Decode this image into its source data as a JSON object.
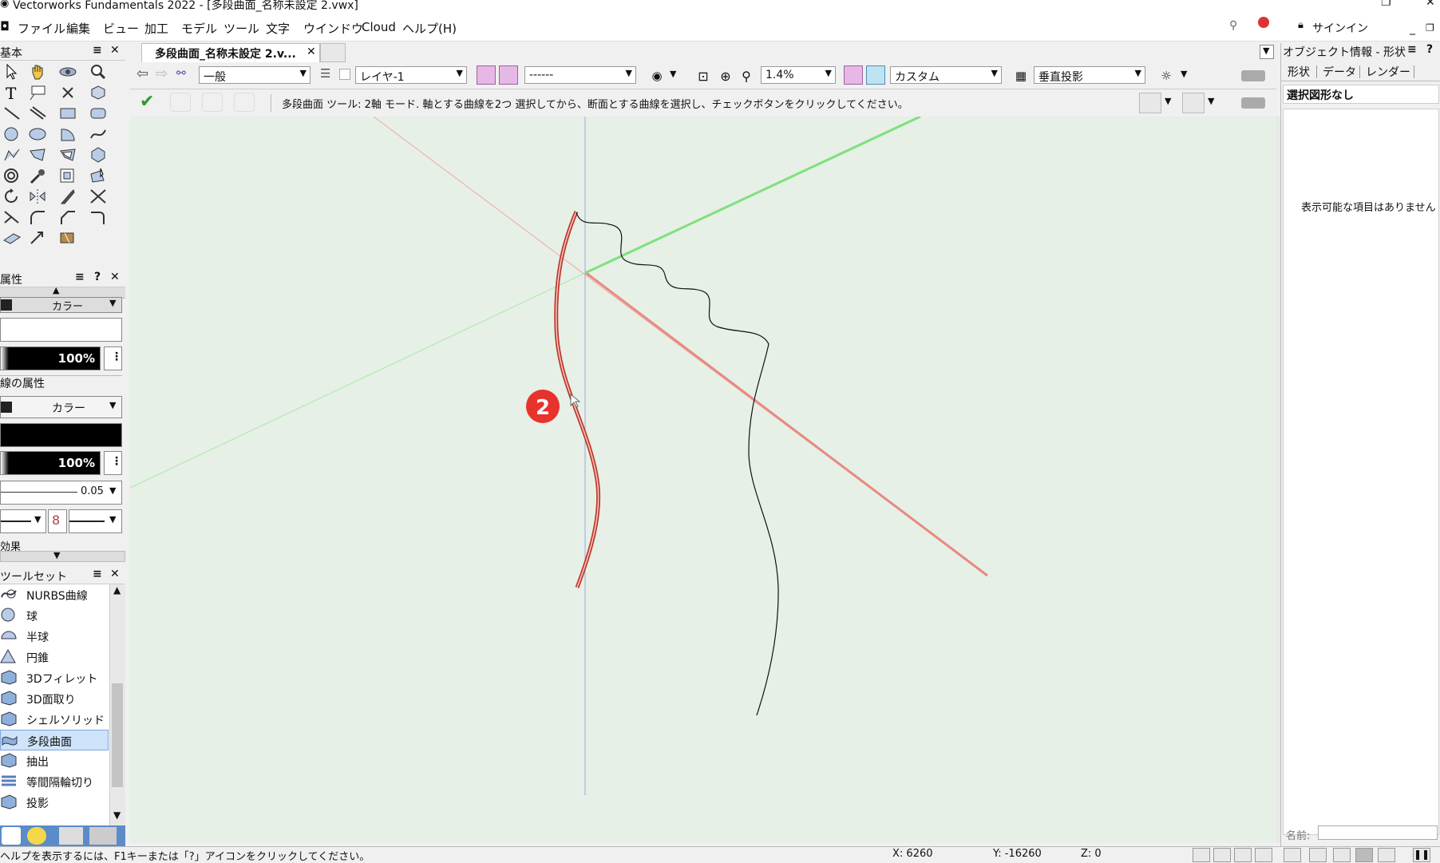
{
  "app": {
    "title": "Vectorworks Fundamentals 2022 - [多段曲面_名称未設定 2.vwx]"
  },
  "menubar": {
    "items": [
      "ファイル",
      "編集",
      "ビュー",
      "加工",
      "モデル",
      "ツール",
      "文字",
      "ウインドウ",
      "Cloud",
      "ヘルプ(H)"
    ],
    "signin": "サインイン"
  },
  "basic_palette": {
    "title": "基本"
  },
  "attributes": {
    "title": "属性",
    "fill_type": "カラー",
    "fill_opacity": "100%",
    "line_section_title": "線の属性",
    "line_type": "カラー",
    "line_opacity": "100%",
    "line_thickness": "0.05",
    "effects": "効果"
  },
  "toolset": {
    "title": "ツールセット",
    "items": [
      {
        "label": "NURBS曲線",
        "selected": false
      },
      {
        "label": "球",
        "selected": false
      },
      {
        "label": "半球",
        "selected": false
      },
      {
        "label": "円錐",
        "selected": false
      },
      {
        "label": "3Dフィレット",
        "selected": false
      },
      {
        "label": "3D面取り",
        "selected": false
      },
      {
        "label": "シェルソリッド",
        "selected": false
      },
      {
        "label": "多段曲面",
        "selected": true
      },
      {
        "label": "抽出",
        "selected": false
      },
      {
        "label": "等間隔輪切り",
        "selected": false
      },
      {
        "label": "投影",
        "selected": false
      }
    ]
  },
  "document": {
    "tab_label": "多段曲面_名称未設定 2.v..."
  },
  "viewbar": {
    "class": "一般",
    "layer": "レイヤ-1",
    "line_style": "------",
    "zoom": "1.4%",
    "render": "カスタム",
    "projection": "垂直投影"
  },
  "modebar": {
    "message": "多段曲面 ツール: 2軸 モード. 軸とする曲線を2つ 選択してから、断面とする曲線を選択し、チェックボタンをクリックしてください。"
  },
  "canvas": {
    "marker": "2"
  },
  "obj_info": {
    "title": "オブジェクト情報 - 形状",
    "tabs": [
      "形状",
      "データ",
      "レンダー"
    ],
    "selection": "選択図形なし",
    "empty_message": "表示可能な項目はありません",
    "name_label": "名前:"
  },
  "status": {
    "help": "ヘルプを表示するには、F1キーまたは「?」アイコンをクリックしてください。",
    "x": "X: 6260",
    "y": "Y: -16260",
    "z": "Z: 0"
  },
  "colors": {
    "canvas_bg": "#e6f0e6",
    "accent_red": "#e8322c",
    "selection_blue": "#cfe3fa"
  }
}
